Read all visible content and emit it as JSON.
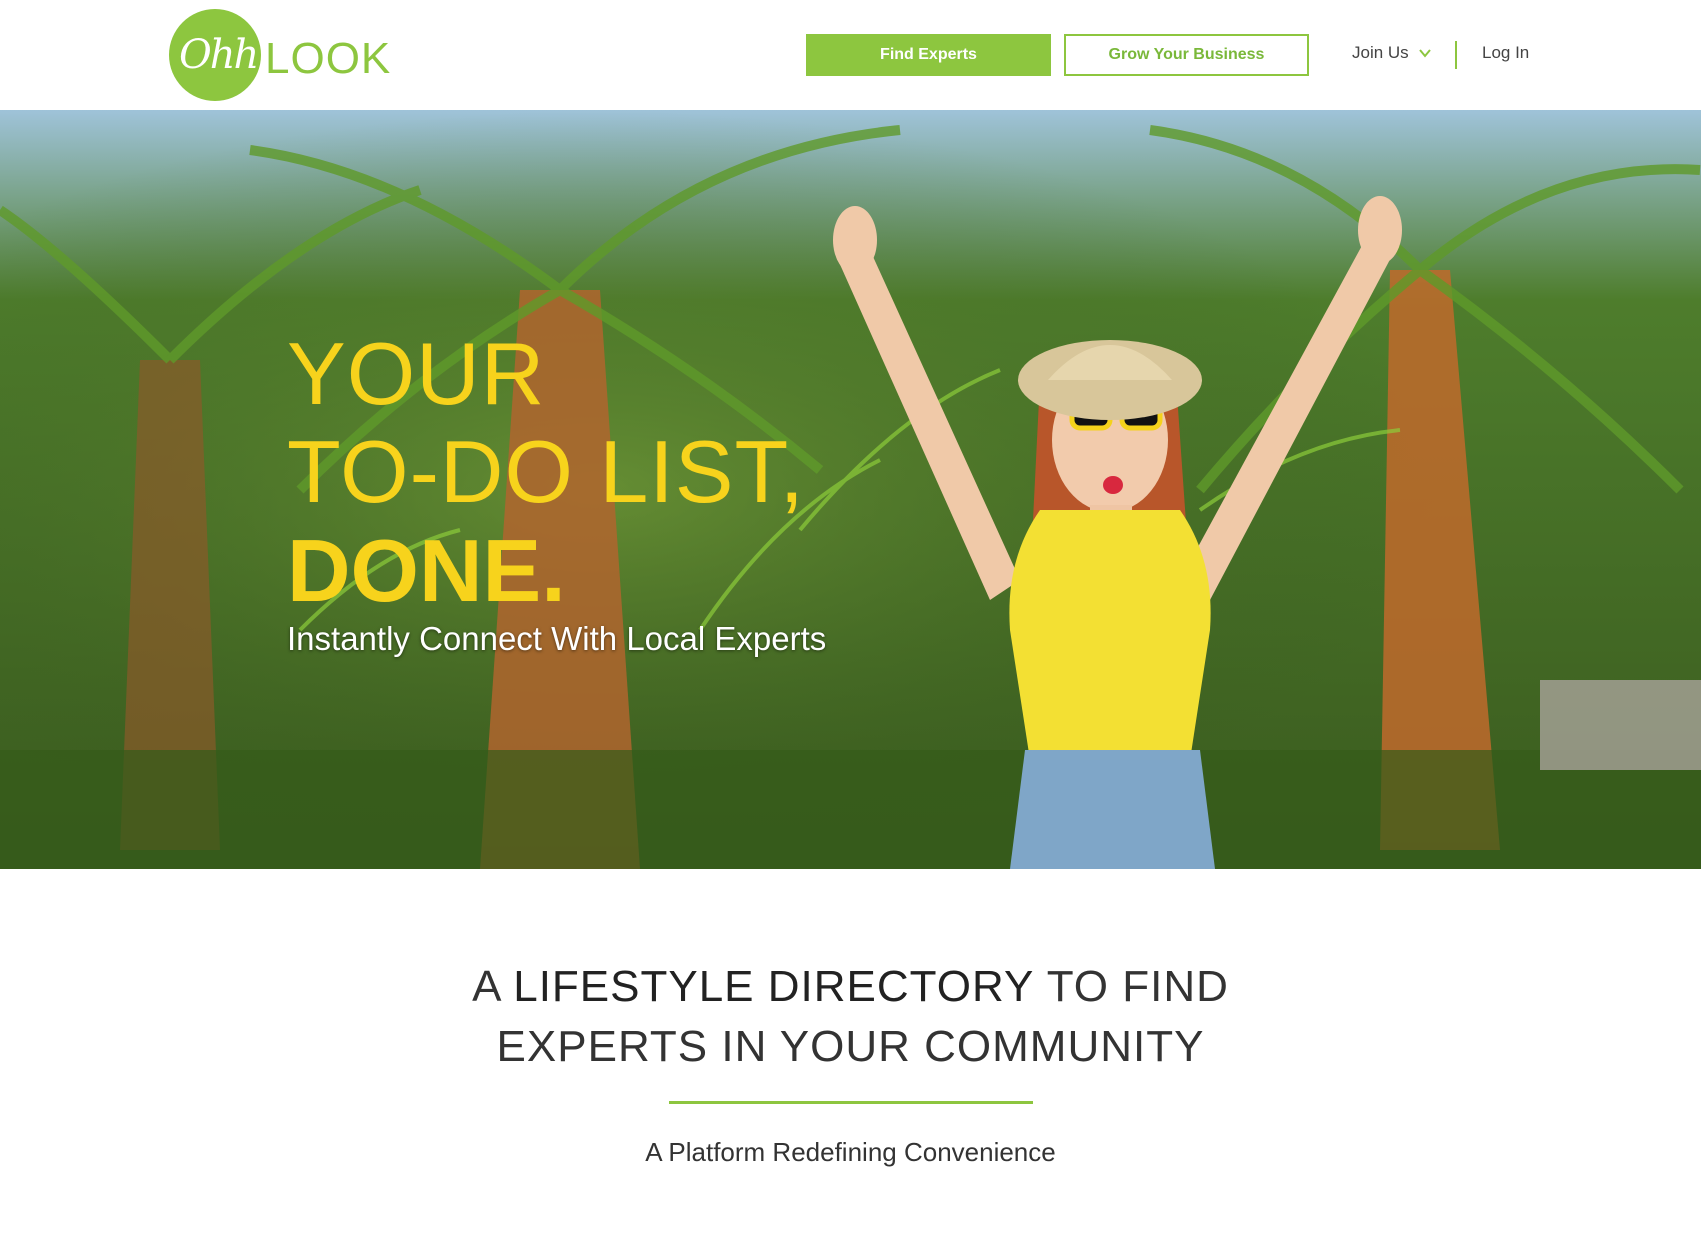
{
  "logo": {
    "ohh": "Ohh",
    "look": "LOOK"
  },
  "nav": {
    "find_experts": "Find Experts",
    "grow_business": "Grow Your Business",
    "join_us": "Join Us",
    "log_in": "Log In"
  },
  "hero": {
    "line1": "YOUR",
    "line2": "TO-DO LIST,",
    "line3": "DONE.",
    "subtitle": "Instantly Connect With Local Experts"
  },
  "section": {
    "headline_a": "A ",
    "headline_bold": "LIFESTYLE DIRECTORY",
    "headline_b": " TO FIND",
    "headline_line2": "EXPERTS IN YOUR COMMUNITY",
    "tagline": "A Platform Redefining Convenience"
  },
  "colors": {
    "brand_green": "#8dc63f",
    "hero_yellow": "#f7d31c"
  }
}
